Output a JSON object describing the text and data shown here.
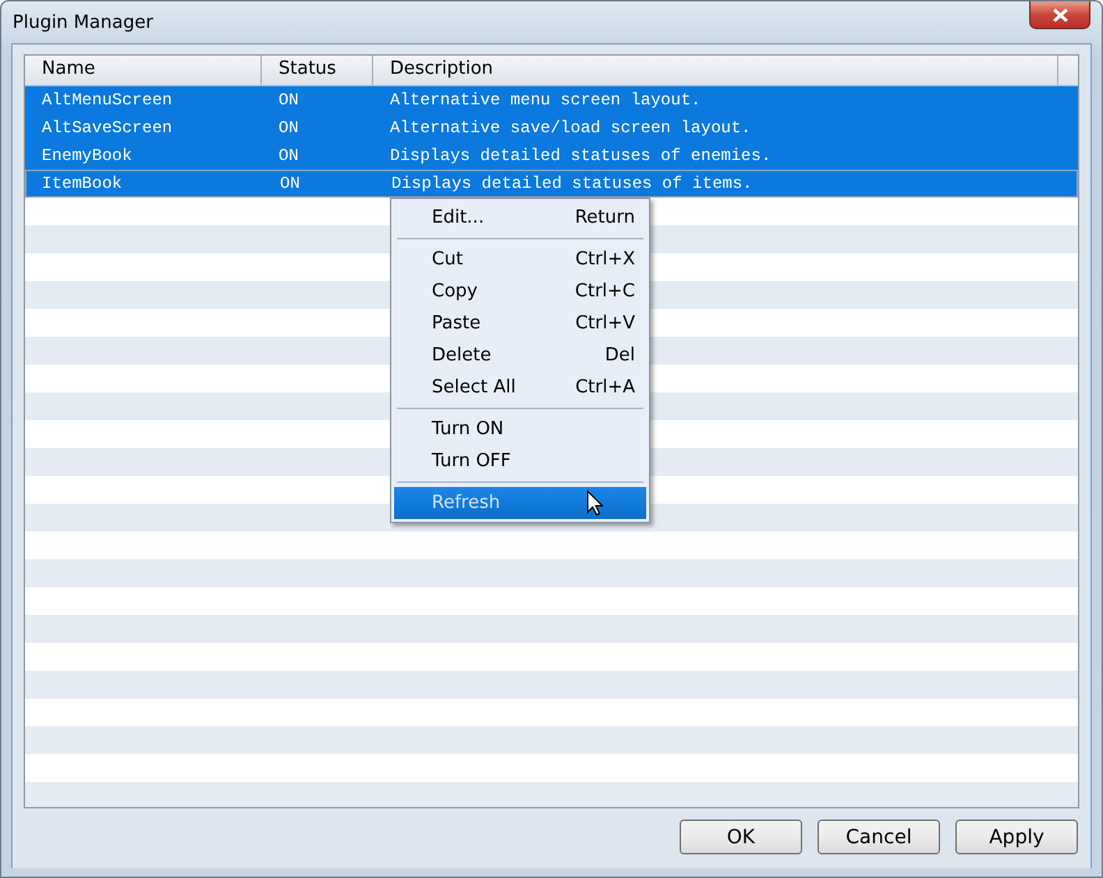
{
  "window": {
    "title": "Plugin Manager"
  },
  "table": {
    "columns": [
      "Name",
      "Status",
      "Description"
    ],
    "rows": [
      {
        "name": "AltMenuScreen",
        "status": "ON",
        "description": "Alternative menu screen layout.",
        "selected": true,
        "focused": false
      },
      {
        "name": "AltSaveScreen",
        "status": "ON",
        "description": "Alternative save/load screen layout.",
        "selected": true,
        "focused": false
      },
      {
        "name": "EnemyBook",
        "status": "ON",
        "description": "Displays detailed statuses of enemies.",
        "selected": true,
        "focused": false
      },
      {
        "name": "ItemBook",
        "status": "ON",
        "description": "Displays detailed statuses of items.",
        "selected": true,
        "focused": true
      }
    ]
  },
  "context_menu": {
    "items": [
      {
        "kind": "item",
        "label": "Edit...",
        "shortcut": "Return",
        "selected": false
      },
      {
        "kind": "separator"
      },
      {
        "kind": "item",
        "label": "Cut",
        "shortcut": "Ctrl+X",
        "selected": false
      },
      {
        "kind": "item",
        "label": "Copy",
        "shortcut": "Ctrl+C",
        "selected": false
      },
      {
        "kind": "item",
        "label": "Paste",
        "shortcut": "Ctrl+V",
        "selected": false
      },
      {
        "kind": "item",
        "label": "Delete",
        "shortcut": "Del",
        "selected": false
      },
      {
        "kind": "item",
        "label": "Select All",
        "shortcut": "Ctrl+A",
        "selected": false
      },
      {
        "kind": "separator"
      },
      {
        "kind": "item",
        "label": "Turn ON",
        "selected": false
      },
      {
        "kind": "item",
        "label": "Turn OFF",
        "selected": false
      },
      {
        "kind": "separator"
      },
      {
        "kind": "item",
        "label": "Refresh",
        "selected": true
      }
    ]
  },
  "buttons": [
    "OK",
    "Cancel",
    "Apply"
  ]
}
